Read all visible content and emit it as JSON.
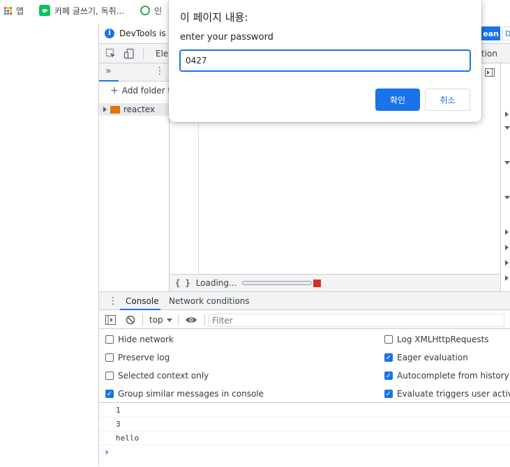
{
  "bookmarks": {
    "apps_label": "앱",
    "items": [
      {
        "label": "카페 글쓰기, 독취..."
      },
      {
        "label": "인"
      }
    ]
  },
  "devtools": {
    "infobar_text": "DevTools is no",
    "info_button": "ean",
    "info_button2": "D",
    "main_tab_fragment": "Elen",
    "right_tab_fragment": "tion",
    "sources": {
      "add_folder_label": "Add folder to",
      "folder_name": "reactex",
      "status_loading": "Loading..."
    },
    "drawer": {
      "tabs": [
        {
          "label": "Console"
        },
        {
          "label": "Network conditions"
        }
      ],
      "context": "top",
      "filter_placeholder": "Filter",
      "settings_left": [
        {
          "label": "Hide network",
          "checked": false
        },
        {
          "label": "Preserve log",
          "checked": false
        },
        {
          "label": "Selected context only",
          "checked": false
        },
        {
          "label": "Group similar messages in console",
          "checked": true
        }
      ],
      "settings_right": [
        {
          "label": "Log XMLHttpRequests",
          "checked": false
        },
        {
          "label": "Eager evaluation",
          "checked": true
        },
        {
          "label": "Autocomplete from history",
          "checked": true
        },
        {
          "label": "Evaluate triggers user activation",
          "checked": true
        }
      ],
      "messages": [
        "1",
        "3",
        "hello"
      ],
      "prompt_symbol": "›"
    }
  },
  "dialog": {
    "title": "이 페이지 내용:",
    "message": "enter your password",
    "input_value": "0427",
    "ok_label": "확인",
    "cancel_label": "취소"
  },
  "colors": {
    "accent": "#1a73e8",
    "record_red": "#d93025"
  }
}
